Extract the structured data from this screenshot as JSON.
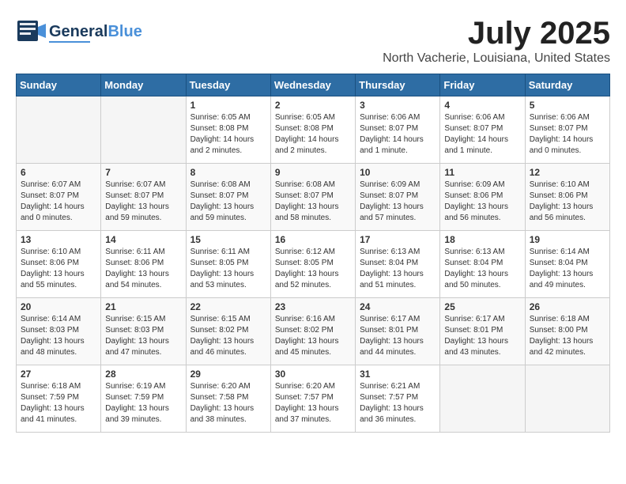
{
  "header": {
    "logo_line1": "General",
    "logo_line2": "Blue",
    "month": "July 2025",
    "location": "North Vacherie, Louisiana, United States"
  },
  "days_of_week": [
    "Sunday",
    "Monday",
    "Tuesday",
    "Wednesday",
    "Thursday",
    "Friday",
    "Saturday"
  ],
  "weeks": [
    [
      {
        "day": "",
        "info": ""
      },
      {
        "day": "",
        "info": ""
      },
      {
        "day": "1",
        "info": "Sunrise: 6:05 AM\nSunset: 8:08 PM\nDaylight: 14 hours\nand 2 minutes."
      },
      {
        "day": "2",
        "info": "Sunrise: 6:05 AM\nSunset: 8:08 PM\nDaylight: 14 hours\nand 2 minutes."
      },
      {
        "day": "3",
        "info": "Sunrise: 6:06 AM\nSunset: 8:07 PM\nDaylight: 14 hours\nand 1 minute."
      },
      {
        "day": "4",
        "info": "Sunrise: 6:06 AM\nSunset: 8:07 PM\nDaylight: 14 hours\nand 1 minute."
      },
      {
        "day": "5",
        "info": "Sunrise: 6:06 AM\nSunset: 8:07 PM\nDaylight: 14 hours\nand 0 minutes."
      }
    ],
    [
      {
        "day": "6",
        "info": "Sunrise: 6:07 AM\nSunset: 8:07 PM\nDaylight: 14 hours\nand 0 minutes."
      },
      {
        "day": "7",
        "info": "Sunrise: 6:07 AM\nSunset: 8:07 PM\nDaylight: 13 hours\nand 59 minutes."
      },
      {
        "day": "8",
        "info": "Sunrise: 6:08 AM\nSunset: 8:07 PM\nDaylight: 13 hours\nand 59 minutes."
      },
      {
        "day": "9",
        "info": "Sunrise: 6:08 AM\nSunset: 8:07 PM\nDaylight: 13 hours\nand 58 minutes."
      },
      {
        "day": "10",
        "info": "Sunrise: 6:09 AM\nSunset: 8:07 PM\nDaylight: 13 hours\nand 57 minutes."
      },
      {
        "day": "11",
        "info": "Sunrise: 6:09 AM\nSunset: 8:06 PM\nDaylight: 13 hours\nand 56 minutes."
      },
      {
        "day": "12",
        "info": "Sunrise: 6:10 AM\nSunset: 8:06 PM\nDaylight: 13 hours\nand 56 minutes."
      }
    ],
    [
      {
        "day": "13",
        "info": "Sunrise: 6:10 AM\nSunset: 8:06 PM\nDaylight: 13 hours\nand 55 minutes."
      },
      {
        "day": "14",
        "info": "Sunrise: 6:11 AM\nSunset: 8:06 PM\nDaylight: 13 hours\nand 54 minutes."
      },
      {
        "day": "15",
        "info": "Sunrise: 6:11 AM\nSunset: 8:05 PM\nDaylight: 13 hours\nand 53 minutes."
      },
      {
        "day": "16",
        "info": "Sunrise: 6:12 AM\nSunset: 8:05 PM\nDaylight: 13 hours\nand 52 minutes."
      },
      {
        "day": "17",
        "info": "Sunrise: 6:13 AM\nSunset: 8:04 PM\nDaylight: 13 hours\nand 51 minutes."
      },
      {
        "day": "18",
        "info": "Sunrise: 6:13 AM\nSunset: 8:04 PM\nDaylight: 13 hours\nand 50 minutes."
      },
      {
        "day": "19",
        "info": "Sunrise: 6:14 AM\nSunset: 8:04 PM\nDaylight: 13 hours\nand 49 minutes."
      }
    ],
    [
      {
        "day": "20",
        "info": "Sunrise: 6:14 AM\nSunset: 8:03 PM\nDaylight: 13 hours\nand 48 minutes."
      },
      {
        "day": "21",
        "info": "Sunrise: 6:15 AM\nSunset: 8:03 PM\nDaylight: 13 hours\nand 47 minutes."
      },
      {
        "day": "22",
        "info": "Sunrise: 6:15 AM\nSunset: 8:02 PM\nDaylight: 13 hours\nand 46 minutes."
      },
      {
        "day": "23",
        "info": "Sunrise: 6:16 AM\nSunset: 8:02 PM\nDaylight: 13 hours\nand 45 minutes."
      },
      {
        "day": "24",
        "info": "Sunrise: 6:17 AM\nSunset: 8:01 PM\nDaylight: 13 hours\nand 44 minutes."
      },
      {
        "day": "25",
        "info": "Sunrise: 6:17 AM\nSunset: 8:01 PM\nDaylight: 13 hours\nand 43 minutes."
      },
      {
        "day": "26",
        "info": "Sunrise: 6:18 AM\nSunset: 8:00 PM\nDaylight: 13 hours\nand 42 minutes."
      }
    ],
    [
      {
        "day": "27",
        "info": "Sunrise: 6:18 AM\nSunset: 7:59 PM\nDaylight: 13 hours\nand 41 minutes."
      },
      {
        "day": "28",
        "info": "Sunrise: 6:19 AM\nSunset: 7:59 PM\nDaylight: 13 hours\nand 39 minutes."
      },
      {
        "day": "29",
        "info": "Sunrise: 6:20 AM\nSunset: 7:58 PM\nDaylight: 13 hours\nand 38 minutes."
      },
      {
        "day": "30",
        "info": "Sunrise: 6:20 AM\nSunset: 7:57 PM\nDaylight: 13 hours\nand 37 minutes."
      },
      {
        "day": "31",
        "info": "Sunrise: 6:21 AM\nSunset: 7:57 PM\nDaylight: 13 hours\nand 36 minutes."
      },
      {
        "day": "",
        "info": ""
      },
      {
        "day": "",
        "info": ""
      }
    ]
  ]
}
